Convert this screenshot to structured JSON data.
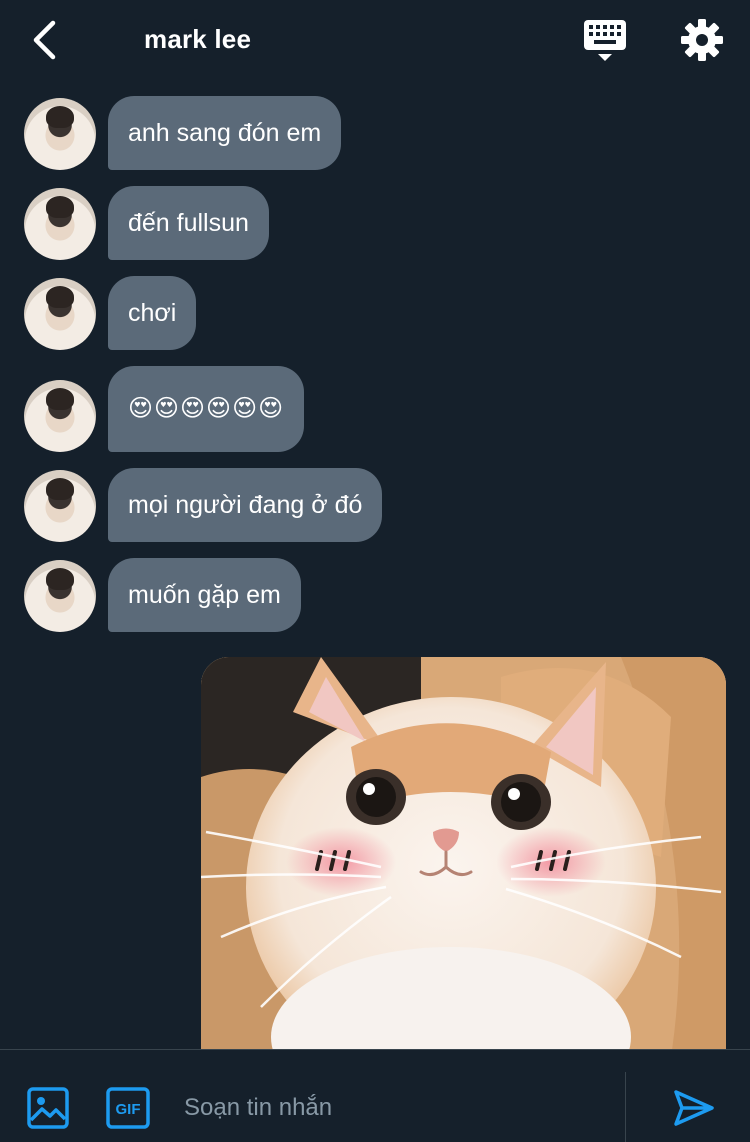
{
  "header": {
    "title": "mark lee"
  },
  "icons": {
    "back": "chevron-left-icon",
    "keyboard": "keyboard-icon",
    "settings": "gear-icon",
    "media": "image-icon",
    "gif": "gif-icon",
    "send": "send-icon"
  },
  "messages": [
    {
      "text": "anh sang đón em"
    },
    {
      "text": "đến fullsun"
    },
    {
      "text": "chơi"
    },
    {
      "text": "😍😍😍😍😍😍"
    },
    {
      "text": "mọi người đang ở đó"
    },
    {
      "text": "muốn gặp em"
    }
  ],
  "composer": {
    "gif_label": "GIF",
    "placeholder": "Soạn tin nhắn"
  },
  "colors": {
    "background": "#15202b",
    "bubble": "#5b6a79",
    "accent": "#1d9bf0",
    "placeholder": "#8899a6"
  }
}
